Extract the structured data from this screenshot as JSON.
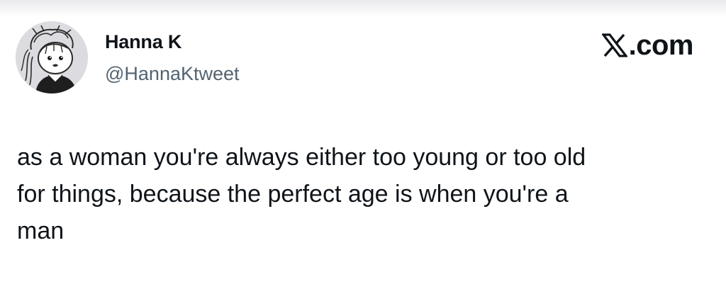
{
  "author": {
    "display_name": "Hanna K",
    "handle": "@HannaKtweet",
    "avatar_icon": "cartoon-girl-avatar"
  },
  "brand": {
    "logo_icon": "x-logo-icon",
    "domain": ".com"
  },
  "tweet": {
    "text": "as a woman you're always either too young or too old\nfor things, because the perfect age is when you're a\nman"
  },
  "colors": {
    "text_primary": "#0f1419",
    "text_secondary": "#536471",
    "background": "#ffffff"
  }
}
